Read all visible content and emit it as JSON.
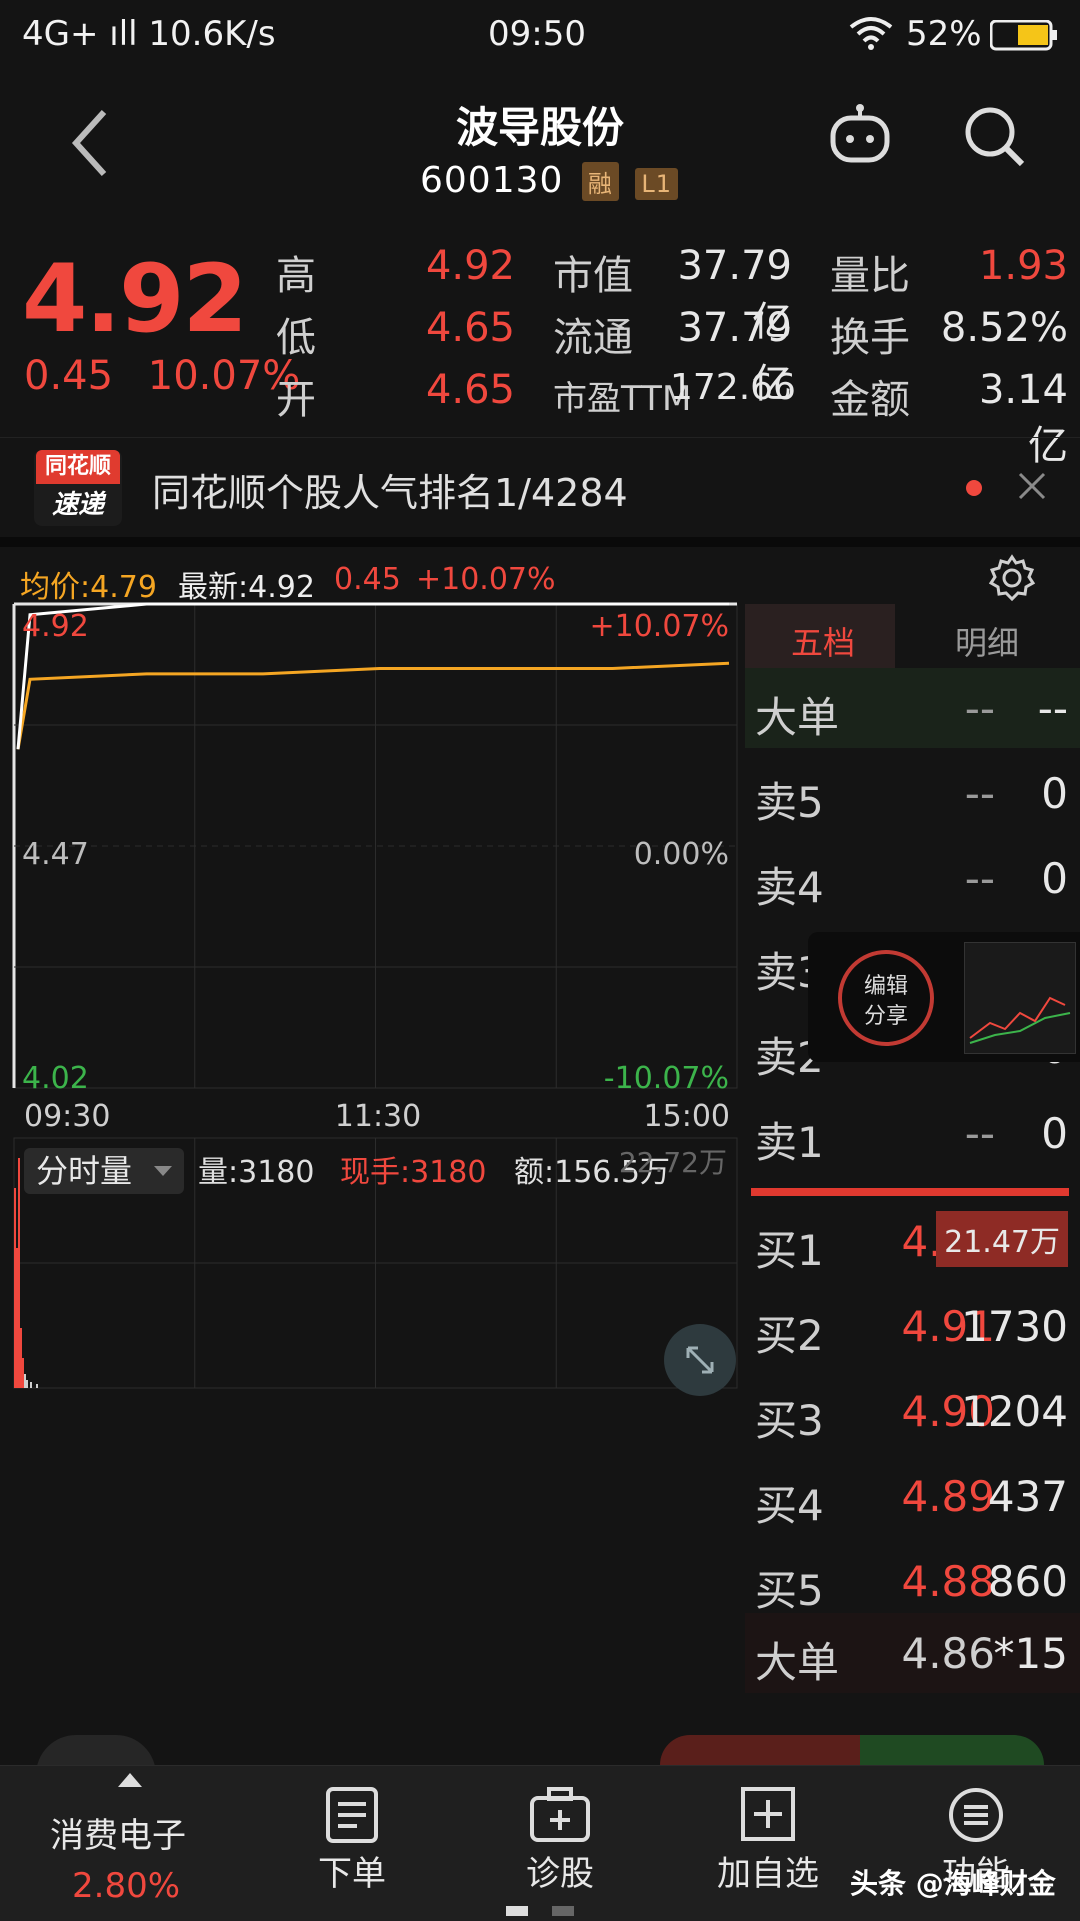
{
  "status_bar": {
    "left": "4G+ ıll 10.6K/s",
    "time": "09:50",
    "battery": "52%"
  },
  "header": {
    "title": "波导股份",
    "code": "600130",
    "tag1": "融",
    "tag2": "L1"
  },
  "quote": {
    "price": "4.92",
    "change": "0.45",
    "change_pct": "10.07%",
    "rows": [
      {
        "l1": "高",
        "v1": "4.92",
        "l2": "市值",
        "v2": "37.79亿",
        "l3": "量比",
        "v3": "1.93"
      },
      {
        "l1": "低",
        "v1": "4.65",
        "l2": "流通",
        "v2": "37.79亿",
        "l3": "换手",
        "v3": "8.52%"
      },
      {
        "l1": "开",
        "v1": "4.65",
        "l2": "市盈TTM",
        "v2": "172.66",
        "l3": "金额",
        "v3": "3.14亿"
      }
    ]
  },
  "news": {
    "badge_top": "同花顺",
    "badge_bottom": "速递",
    "text": "同花顺个股人气排名1/4284"
  },
  "chart_header": {
    "avg": "均价:4.79",
    "latest": "最新:4.92",
    "chg": "0.45",
    "pct": "+10.07%"
  },
  "chart_data": {
    "type": "line",
    "x": [
      "09:30",
      "11:30",
      "15:00"
    ],
    "ylim": [
      4.02,
      4.92
    ],
    "y_ticks_left": [
      "4.92",
      "4.47",
      "4.02"
    ],
    "y_ticks_right": [
      "+10.07%",
      "0.00%",
      "-10.07%"
    ],
    "series": [
      {
        "name": "",
        "values": [
          4.65,
          4.78,
          4.79,
          4.79,
          4.8,
          4.8,
          4.8,
          4.81
        ]
      },
      {
        "name": "",
        "values": [
          4.65,
          4.9,
          4.92,
          4.92,
          4.92,
          4.92,
          4.92,
          4.92
        ]
      }
    ]
  },
  "volume": {
    "label": "分时量",
    "vol": "量:3180",
    "hand": "现手:3180",
    "amt": "额:156.5万",
    "overlay": "22.72万"
  },
  "orderbook": {
    "tabs": [
      "五档",
      "明细"
    ],
    "top": {
      "name": "大单",
      "p": "--",
      "v": "--"
    },
    "sells": [
      {
        "name": "卖5",
        "p": "--",
        "v": "0"
      },
      {
        "name": "卖4",
        "p": "--",
        "v": "0"
      },
      {
        "name": "卖3",
        "p": "--",
        "v": "0"
      },
      {
        "name": "卖2",
        "p": "--",
        "v": "0"
      },
      {
        "name": "卖1",
        "p": "--",
        "v": "0"
      }
    ],
    "buys": [
      {
        "name": "买1",
        "p": "4.92",
        "v": "21.47万"
      },
      {
        "name": "买2",
        "p": "4.91",
        "v": "1730"
      },
      {
        "name": "买3",
        "p": "4.90",
        "v": "1204"
      },
      {
        "name": "买4",
        "p": "4.89",
        "v": "437"
      },
      {
        "name": "买5",
        "p": "4.88",
        "v": "860"
      }
    ],
    "bottom": {
      "name": "大单",
      "p": "4.86",
      "v": "*15"
    }
  },
  "share_popup": {
    "line1": "编辑",
    "line2": "分享"
  },
  "bottom_nav": {
    "sector": "消费电子",
    "sector_pct": "2.80%",
    "items": [
      "下单",
      "诊股",
      "加自选",
      "功能"
    ],
    "watermark": "头条 @海峰财金"
  },
  "colors": {
    "up": "#f0483e",
    "down": "#3cb44b",
    "avg": "#f5a623",
    "bg": "#141414"
  }
}
